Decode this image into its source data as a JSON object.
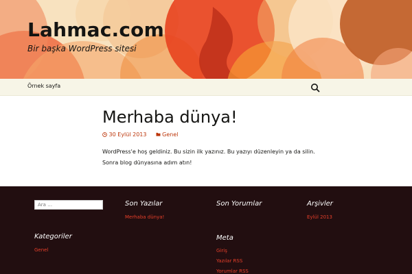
{
  "header": {
    "site_title": "Lahmac.com",
    "site_description": "Bir başka WordPress sitesi",
    "colors": {
      "accent": "#bc360a",
      "bg": "#f8e2bf"
    }
  },
  "nav": {
    "items": [
      {
        "label": "Örnek sayfa"
      }
    ],
    "search_icon": "search-icon"
  },
  "post": {
    "title": "Merhaba dünya!",
    "date": "30 Eylül 2013",
    "date_icon": "clock-icon",
    "category": "Genel",
    "category_icon": "folder-icon",
    "content": "WordPress'e hoş geldiniz. Bu sizin ilk yazınız. Bu yazıyı düzenleyin ya da silin. Sonra blog dünyasına adım atın!"
  },
  "footer": {
    "search": {
      "placeholder": "Ara …"
    },
    "recent_posts": {
      "title": "Son Yazılar",
      "items": [
        "Merhaba dünya!"
      ]
    },
    "recent_comments": {
      "title": "Son Yorumlar"
    },
    "archives": {
      "title": "Arşivler",
      "items": [
        "Eylül 2013"
      ]
    },
    "categories": {
      "title": "Kategoriler",
      "items": [
        "Genel"
      ]
    },
    "meta": {
      "title": "Meta",
      "items": [
        "Giriş",
        "Yazılar RSS",
        "Yorumlar RSS"
      ]
    },
    "colors": {
      "bg": "#220e10",
      "link": "#e63f2a"
    }
  }
}
